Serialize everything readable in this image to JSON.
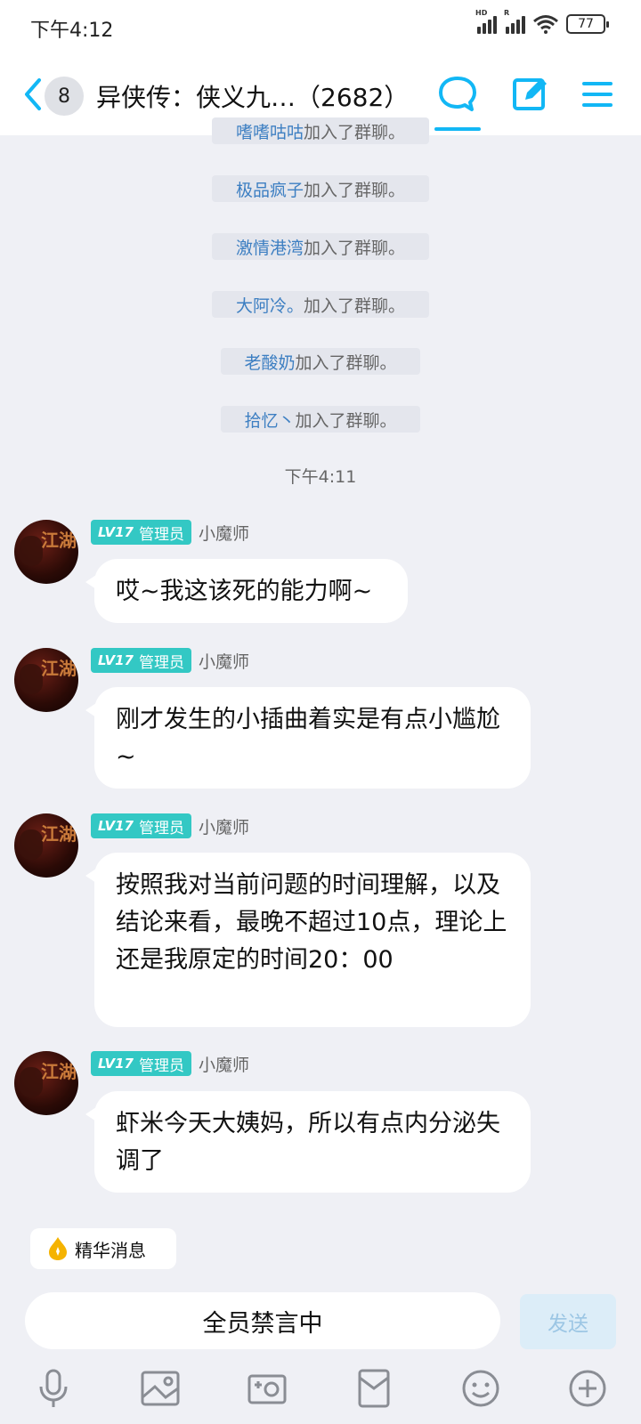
{
  "status_bar": {
    "time": "下午4:12",
    "battery": "77",
    "sig1_tag": "HD",
    "sig2_tag": "R"
  },
  "header": {
    "unread_count": "8",
    "title": "异侠传：侠义九…（2682）"
  },
  "system_messages": [
    {
      "name": "嗜嗜咕咕",
      "text": "加入了群聊。"
    },
    {
      "name": "极品疯子",
      "text": "加入了群聊。"
    },
    {
      "name": "激情港湾",
      "text": "加入了群聊。"
    },
    {
      "name": "大阿冷。",
      "text": "加入了群聊。"
    },
    {
      "name": "老酸奶",
      "text": "加入了群聊。"
    },
    {
      "name": "拾忆丶",
      "text": "加入了群聊。"
    }
  ],
  "time_separator": "下午4:11",
  "messages": [
    {
      "level": "LV17",
      "role": "管理员",
      "sender": "小魔师",
      "text": "哎~我这该死的能力啊~"
    },
    {
      "level": "LV17",
      "role": "管理员",
      "sender": "小魔师",
      "text": "刚才发生的小插曲着实是有点小尴尬~"
    },
    {
      "level": "LV17",
      "role": "管理员",
      "sender": "小魔师",
      "text": "按照我对当前问题的时间理解，以及结论来看，最晚不超过10点，理论上还是我原定的时间20：00"
    },
    {
      "level": "LV17",
      "role": "管理员",
      "sender": "小魔师",
      "text": "虾米今天大姨妈，所以有点内分泌失调了"
    }
  ],
  "avatar_text": "江湖",
  "essence_label": "精华消息",
  "input": {
    "placeholder": "全员禁言中",
    "send_label": "发送"
  },
  "colors": {
    "accent": "#12b7f5",
    "badge": "#33c8c4",
    "nick": "#3d7fc2",
    "background": "#eff0f5"
  },
  "icons": {
    "header": [
      "chevron-left-icon",
      "chat-bubble-icon",
      "edit-icon",
      "menu-icon"
    ],
    "toolbar": [
      "microphone-icon",
      "image-icon",
      "camera-icon",
      "red-packet-icon",
      "emoji-icon",
      "plus-icon"
    ]
  }
}
